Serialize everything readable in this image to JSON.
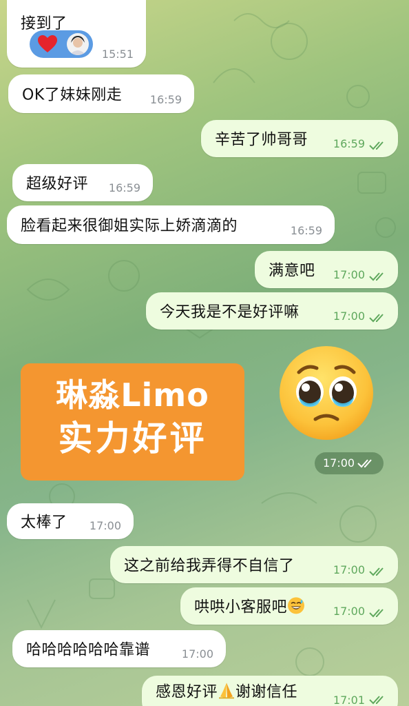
{
  "messages": [
    {
      "id": "m1",
      "side": "in",
      "text": "接到了",
      "time": "15:51",
      "reactions": [
        "heart-icon",
        "avatar"
      ]
    },
    {
      "id": "m2",
      "side": "in",
      "text": "OK了妹妹刚走",
      "time": "16:59"
    },
    {
      "id": "m3",
      "side": "out",
      "text": "辛苦了帅哥哥",
      "time": "16:59",
      "status": "read"
    },
    {
      "id": "m4",
      "side": "in",
      "text": "超级好评",
      "time": "16:59"
    },
    {
      "id": "m5",
      "side": "in",
      "text": "脸看起来很御姐实际上娇滴滴的",
      "time": "16:59"
    },
    {
      "id": "m6",
      "side": "out",
      "text": "满意吧",
      "time": "17:00",
      "status": "read"
    },
    {
      "id": "m7",
      "side": "out",
      "text": "今天我是不是好评嘛",
      "time": "17:00",
      "status": "read"
    },
    {
      "id": "m9",
      "side": "in",
      "text": "太棒了",
      "time": "17:00"
    },
    {
      "id": "m10",
      "side": "out",
      "text": "这之前给我弄得不自信了",
      "time": "17:00",
      "status": "read"
    },
    {
      "id": "m11",
      "side": "out",
      "text": "哄哄小客服吧",
      "time": "17:00",
      "status": "read",
      "emoji": "sweat-smile-emoji"
    },
    {
      "id": "m12",
      "side": "in",
      "text": "哈哈哈哈哈哈靠谱",
      "time": "17:00"
    },
    {
      "id": "m13",
      "side": "out",
      "text_before": "感恩好评",
      "text_after": "谢谢信任",
      "time": "17:01",
      "status": "read",
      "emoji": "folded-hands-emoji"
    }
  ],
  "sticker": {
    "line1": "琳淼Limo",
    "line2": "实力好评",
    "emoji": "pleading-face-emoji",
    "time": "17:00",
    "background": "#f49630"
  },
  "colors": {
    "incoming_bubble": "#ffffff",
    "outgoing_bubble": "#eefcdf",
    "read_ticks": "#5fa85d",
    "reaction_pill": "#5b9be3"
  }
}
